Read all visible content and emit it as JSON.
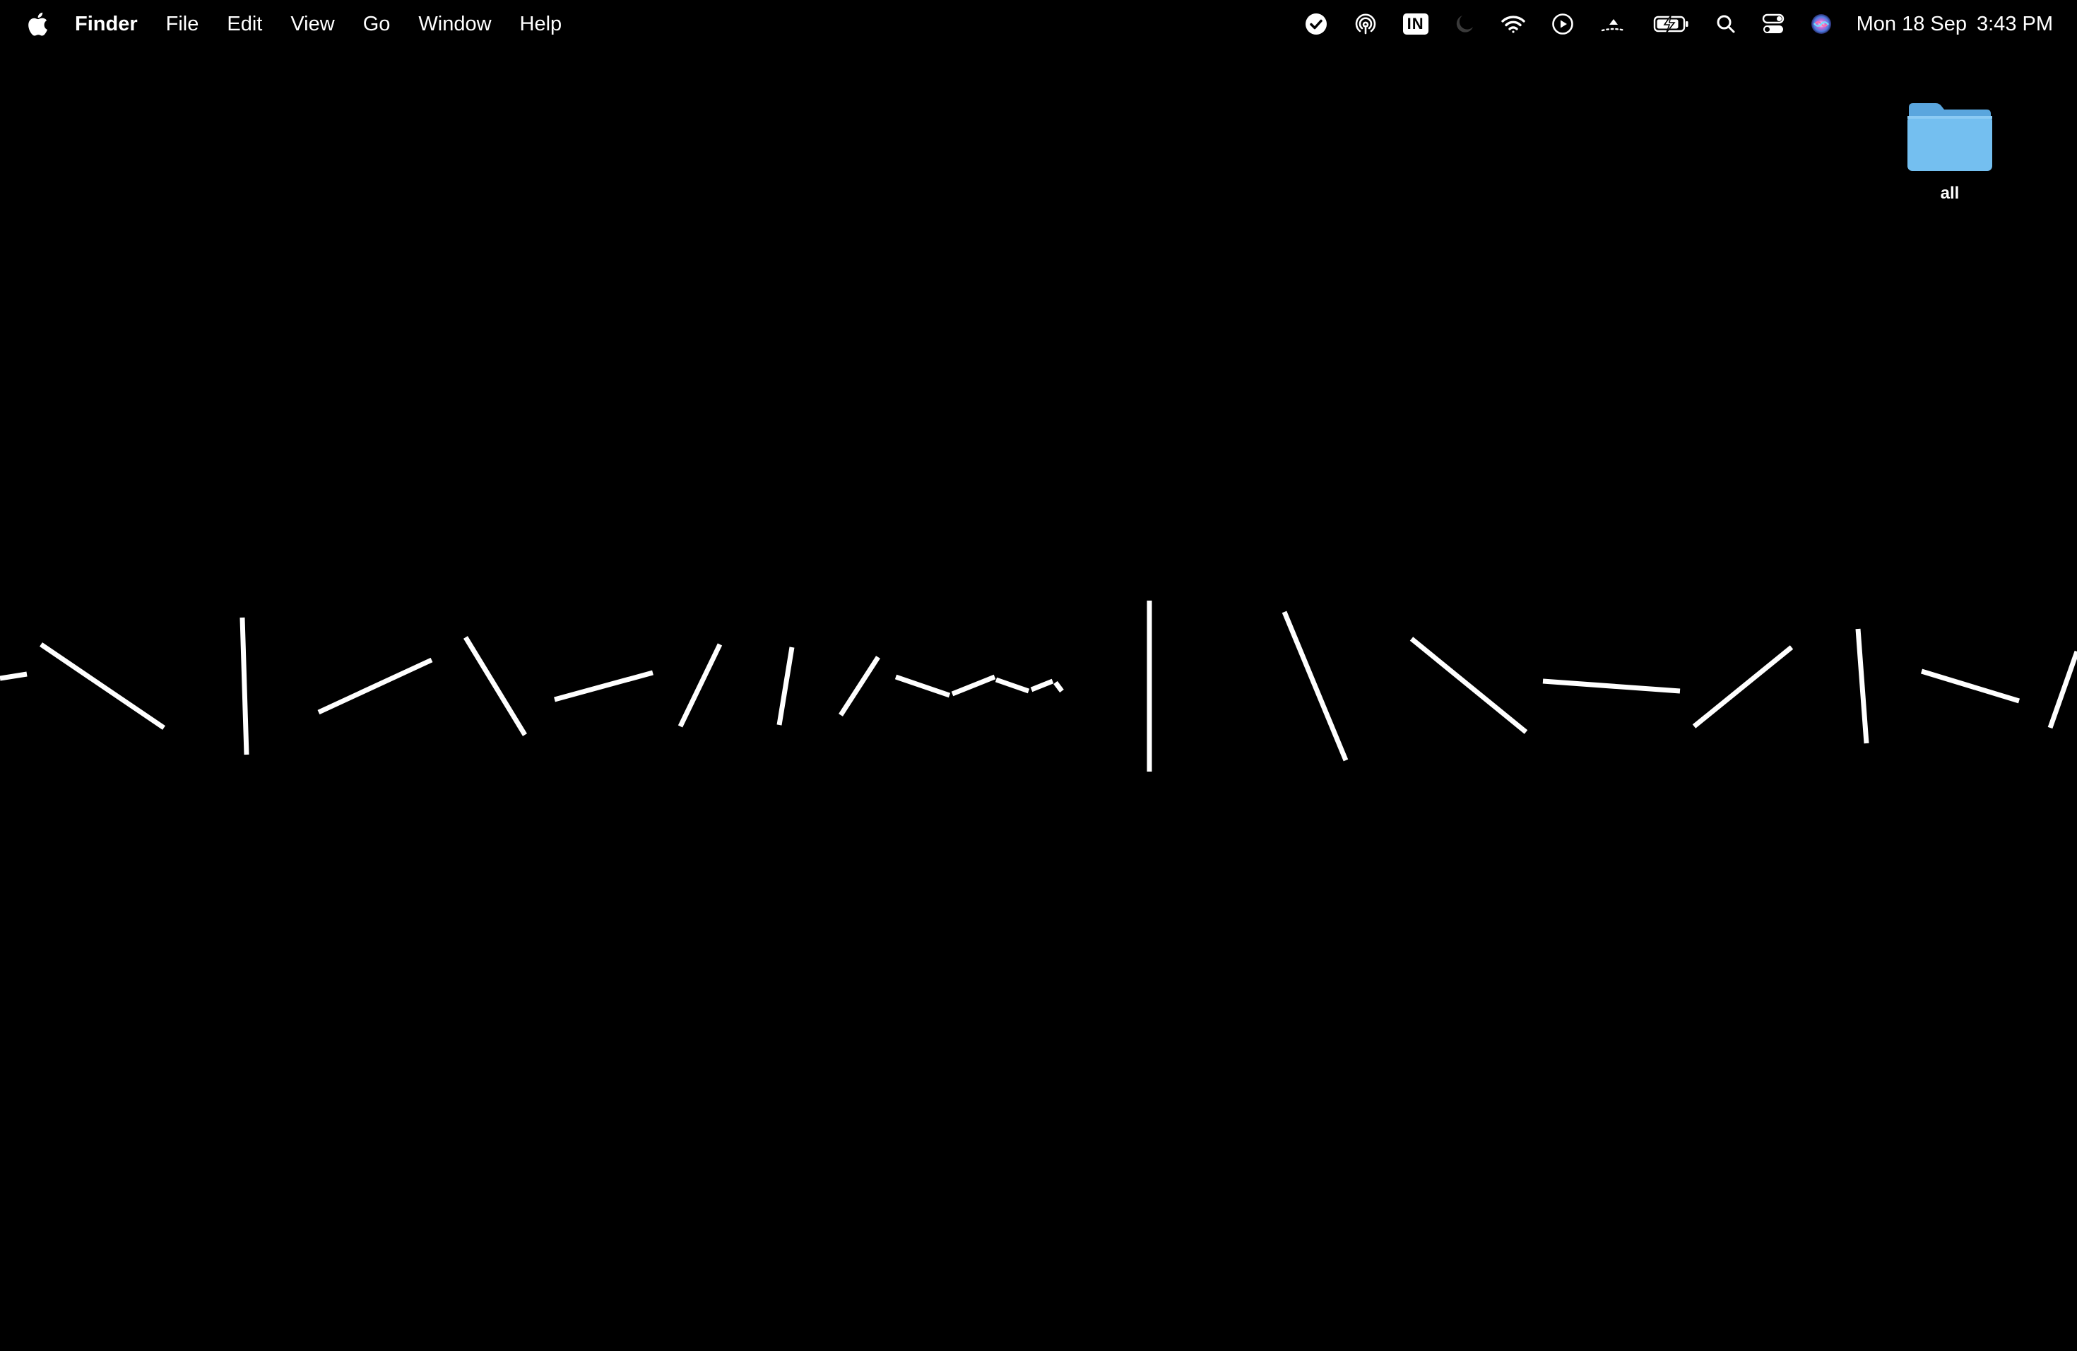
{
  "menubar": {
    "apple_icon": "apple-logo-icon",
    "app_name": "Finder",
    "menus": [
      "File",
      "Edit",
      "View",
      "Go",
      "Window",
      "Help"
    ],
    "status_icons": [
      "checkmark-circle-icon",
      "airdrop-icon",
      "input-source-icon",
      "focus-moon-icon",
      "wifi-icon",
      "now-playing-icon",
      "screen-mirroring-icon",
      "battery-charging-icon",
      "spotlight-search-icon",
      "control-center-icon",
      "siri-icon"
    ],
    "input_source": "IN",
    "date": "Mon 18 Sep",
    "time": "3:43 PM"
  },
  "desktop": {
    "folders": [
      {
        "label": "all",
        "icon": "folder-icon",
        "color": "#74bff0"
      }
    ]
  },
  "wallpaper": {
    "description_icon": "line-segments-wallpaper",
    "background": "#000000",
    "stroke": "#ffffff"
  }
}
